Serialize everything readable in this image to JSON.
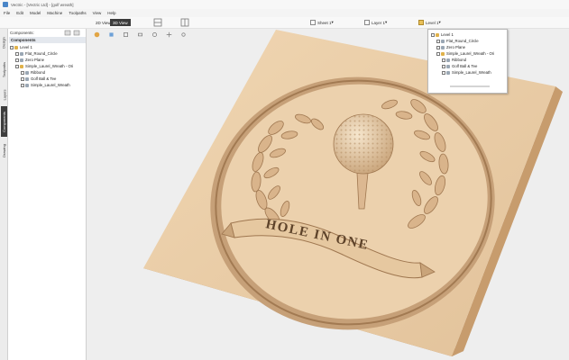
{
  "app": {
    "title": "Vectric - [Vectric Ltd] - [golf wreath]"
  },
  "menu": [
    "File",
    "Edit",
    "Model",
    "Machine",
    "Toolpaths",
    "View",
    "Help"
  ],
  "toolbar": {
    "view2d_label": "2D View",
    "view3d_label": "3D View",
    "sheet_label": "Sheet 1",
    "layer_label": "Layer 1",
    "level_label": "Level 1"
  },
  "side_tabs": [
    "Design",
    "Toolpaths",
    "Layers",
    "Components",
    "Drawing"
  ],
  "panel": {
    "label": "Components:",
    "header": "Components",
    "tree": [
      "Level 1",
      "Flat_Round_Circle",
      "Zero Plane",
      "Simple_Laurel_Wreath - Ori",
      "Ribbond",
      "Golf Ball & Tee",
      "Simple_Laurel_Wreath"
    ]
  },
  "popup": {
    "tree": [
      "Level 1",
      "Flat_Round_Circle",
      "Zero Plane",
      "Simple_Laurel_Wreath - Ori",
      "Ribbond",
      "Golf Ball & Tee",
      "Simple_Laurel_Wreath"
    ]
  },
  "model": {
    "ribbon_text": "HOLE IN ONE"
  },
  "colors": {
    "wood": "#e7c9a3",
    "wood_dark": "#b98f66",
    "selected_tab": "#3b3b3b",
    "tree_header": "#e4e8ee"
  }
}
